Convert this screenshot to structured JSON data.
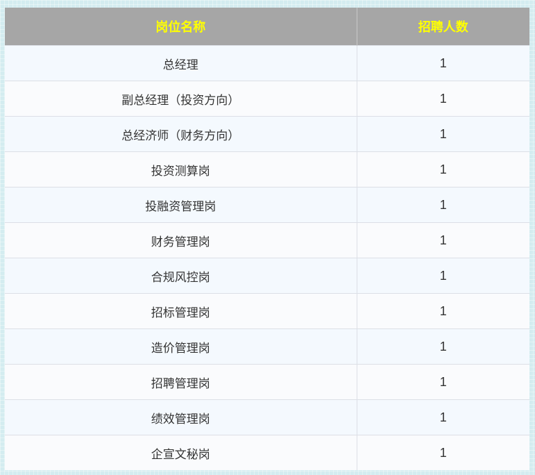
{
  "table": {
    "headers": [
      "岗位名称",
      "招聘人数"
    ],
    "rows": [
      {
        "position": "总经理",
        "count": "1"
      },
      {
        "position": "副总经理（投资方向）",
        "count": "1"
      },
      {
        "position": "总经济师（财务方向）",
        "count": "1"
      },
      {
        "position": "投资测算岗",
        "count": "1"
      },
      {
        "position": "投融资管理岗",
        "count": "1"
      },
      {
        "position": "财务管理岗",
        "count": "1"
      },
      {
        "position": "合规风控岗",
        "count": "1"
      },
      {
        "position": "招标管理岗",
        "count": "1"
      },
      {
        "position": "造价管理岗",
        "count": "1"
      },
      {
        "position": "招聘管理岗",
        "count": "1"
      },
      {
        "position": "绩效管理岗",
        "count": "1"
      },
      {
        "position": "企宣文秘岗",
        "count": "1"
      }
    ]
  },
  "colors": {
    "header_bg": "#a6a6a6",
    "header_text": "#ffff00",
    "page_bg": "#d4ecf0"
  }
}
